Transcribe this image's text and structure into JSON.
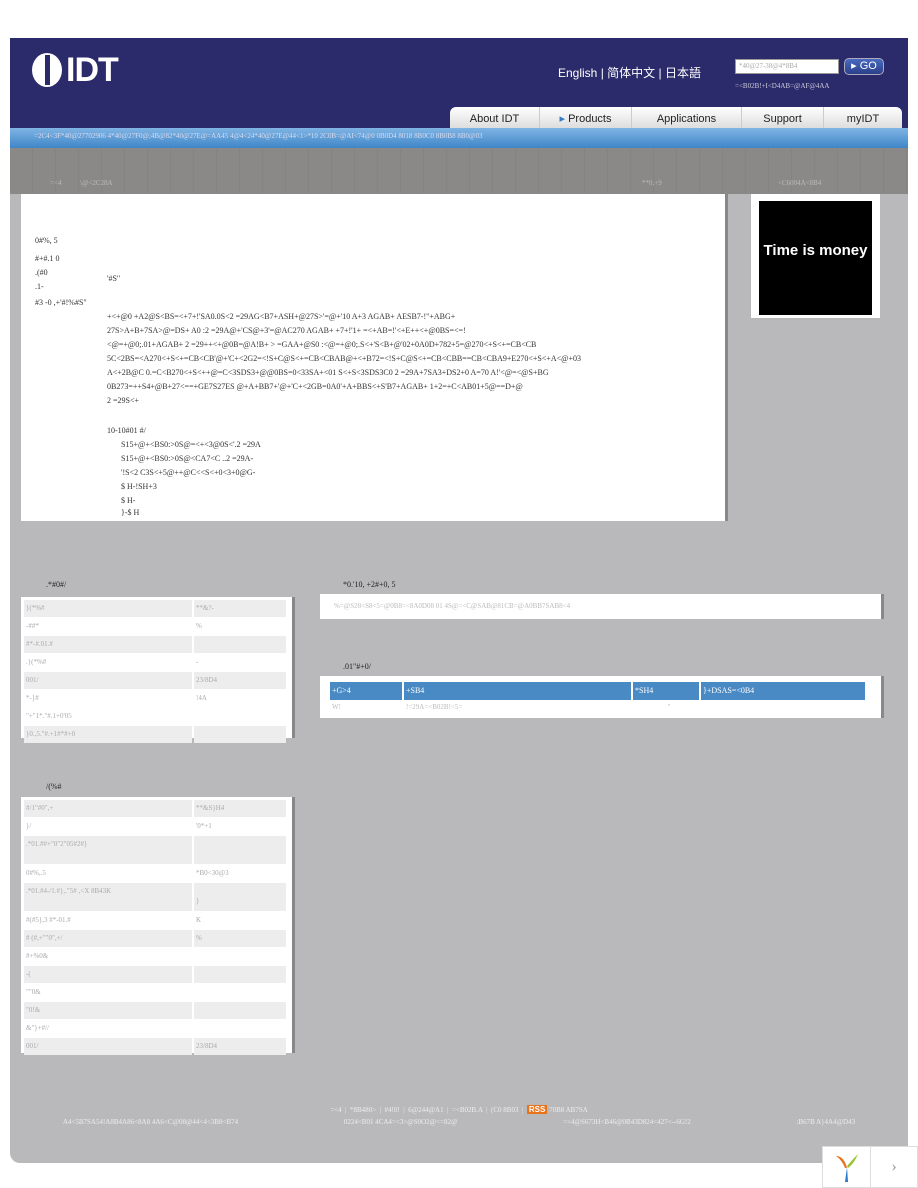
{
  "header": {
    "logo": "IDT",
    "languages": [
      "English",
      "简体中文",
      "日本語"
    ],
    "search_placeholder": "*40@27-38@4*8B4",
    "go_label": "GO",
    "advanced_search": "=<B02B!+I<D4AB=@AF@4AA"
  },
  "nav": [
    "About IDT",
    "Products",
    "Applications",
    "Support",
    "myIDT"
  ],
  "breadcrumb": "=2C4<3F*40@27702906 4*40@27F0@;4B@82*40@27E@=AA45 4@4<24*40@27E@44<1>*10 2C0B=@AI<74@0 0B0D4 8018 8B0C0 8B0B8 8B0@03",
  "stripe": {
    "left": "=<4",
    "left2": "\\@<2C28A",
    "mid": "**0,+9",
    "right": "<C6004A<8B4"
  },
  "main": {
    "labels": [
      "0#%, 5",
      "#+#.1 0",
      ".(#0",
      ".1-",
      "#3 -0 ,+'#!%#S\""
    ],
    "sub": "'#S\"",
    "paragraph": [
      "+<+@0 +A2@S<BS=<+7+!'SA0.0S<2 =29AG<B7+ASH+@27S>'=@+'10 A+3 AGAB+ AESB7-!\"+ABG+",
      "27S>A+B+7SA>@=DS+ A0 :2 =29A@+'CS@+3'=@AC270 AGAB+ +7+!'1+ =<+AB=!'<+E++<+@0BS=<=!",
      "<@=+@0;.01+AGAB+ 2 =29++<+@0B=@A!B+ > =GAA+@S0 :<@=+@0;.S<+'S<B+@'02+0A0D+782+5=@270<+S<+=CB<CB",
      "5C<2BS=<A270<+S<+=CB<CB'@+'C+<2G2=<!S+C@S<+=CB<CBAB@+<+B72=<!S+C@S<+=CB<CBB==CB<CBA9+E270<+S<+A<@+03",
      "A<+2B@C 0.=C<B270<+S<++@=C<3SDS3+@@0BS=0<33SA+<01 S<+S<3SDS3C0 2 =29A+7SA3+DS2+0 A=70 A!'<@=<@S+BG",
      "0B273=++S4+@B+27<==+GE7S27ES @+A+BB7+'@+'C+<2GB=0A0'+A+BBS<+S'B7+AGAB+ 1+2=+C<AB01+5@==D+@",
      "2 =29S<+"
    ],
    "list_title": "10-10#01 #/",
    "list": [
      "S15+@+<BS0:>0S@=<+<3@0S<'.2 =29A",
      "S15+@+<BS0:>0S@<CA7<C ..2 =29A-",
      "'!S<2 C3S<+5@++@C<<S<+0<3+0@G-",
      "$ H-!SH+3",
      "$ H-",
      "}-$ H"
    ]
  },
  "ad": {
    "text": "Time is money"
  },
  "specs": {
    "title": ".*#0#/",
    "rows": [
      [
        "}(*%#",
        "**&?-"
      ],
      [
        "-##*",
        "%"
      ],
      [
        "#*-#.01.#",
        ""
      ],
      [
        ".}(*%#",
        "-"
      ],
      [
        "001/",
        "23/8D4"
      ],
      [
        "*-}#",
        "!4A"
      ],
      [
        "\"+\"1*.\"#.1+0'05",
        ""
      ],
      [
        "}0.,5.\"#.+1#*#+0",
        ""
      ]
    ]
  },
  "docs": {
    "title": "*0.'10, +2#+0, 5",
    "text": "%=@S28<S8<5=@0B8=<8A0D08 01 4S@=<C@SAB@81CB=@A0BB7SAB8<4"
  },
  "ordering": {
    "title": ".01\"#+0/",
    "headers": [
      "+G>4",
      "+SB4",
      "*SH4",
      "}+DSAS=<0B4"
    ],
    "row": [
      "W!",
      "!=29A=<B02B!<5=",
      "\"",
      ""
    ]
  },
  "packaging": {
    "title": "/(%#",
    "rows": [
      [
        "#/1\"#0\",+",
        "**&S}H4"
      ],
      [
        "}/",
        "'0*+1"
      ],
      [
        ".*01.##+\"0\"2\"05#2#}",
        ""
      ],
      [
        "0#%,.5",
        "*B0<30@3"
      ],
      [
        ".*01.#4-/1.#},.\"5# ,<X 8B43K",
        "}"
      ],
      [
        "#(#5},3 #*-01.#",
        "K"
      ],
      [
        "# (#,+\"\"0\",+/",
        "%"
      ],
      [
        "#+%0&",
        ""
      ],
      [
        "-(",
        ""
      ],
      [
        "\"\"0&",
        ""
      ],
      [
        "\"0!&",
        ""
      ],
      [
        "&\"}+#//",
        ""
      ],
      [
        "001/",
        "23/8D4"
      ]
    ]
  },
  "footer": {
    "links": [
      "=<4",
      "*8B480>",
      "#4!0!",
      "6@244@A1",
      "=<B02B.A",
      "(C0 8B03"
    ],
    "rss": "RSS",
    "rss_label": "70B8 AB7SA",
    "row2": [
      "A4<5B7SA54!A8B4A86<8A8 4A6<C@08@44<4<3B8<B74",
      "0224<B01 4CA4=<3>@S0O2@<=82@",
      "=<4@S673H<B46@0B43D824<427<--6G!2",
      ":B67B A}4A4@D43"
    ]
  },
  "colors": {
    "header": "#2b2a6b",
    "breadcrumb": "#4a8ac4",
    "background": "#b9b8bb",
    "table_header": "#4a8ac4",
    "rss": "#e8731a"
  }
}
